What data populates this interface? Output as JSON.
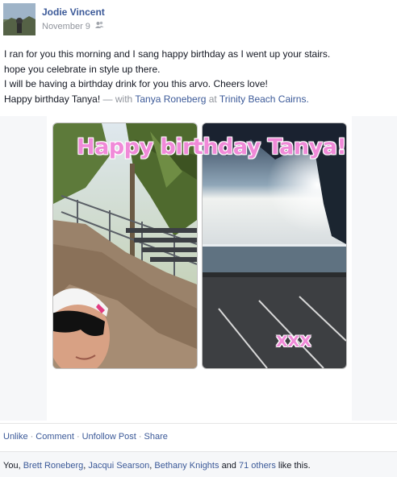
{
  "post": {
    "author": "Jodie Vincent",
    "date": "November 9",
    "audience_icon": "friends-icon",
    "message_lines": [
      "I ran for you this morning and I sang happy birthday as I went up your stairs.",
      "hope you celebrate in style up there.",
      "I will be having a birthday drink for you this arvo. Cheers love!"
    ],
    "last_line": {
      "text": "Happy birthday Tanya!",
      "separator": "— with",
      "tagged": "Tanya Roneberg",
      "at": "at",
      "place": "Trinity Beach Cairns."
    }
  },
  "photo": {
    "banner": "Happy birthday Tanya!",
    "signoff": "XXX"
  },
  "actions": {
    "unlike": "Unlike",
    "comment": "Comment",
    "unfollow": "Unfollow Post",
    "share": "Share",
    "dot": "·"
  },
  "likes": {
    "you": "You,",
    "name1": "Brett Roneberg",
    "name2": "Jacqui Searson",
    "name3": "Bethany Knights",
    "and": "and",
    "others": "71 others",
    "suffix": "like this."
  },
  "colors": {
    "link": "#3b5998",
    "banner_pink": "#f08ad8"
  }
}
